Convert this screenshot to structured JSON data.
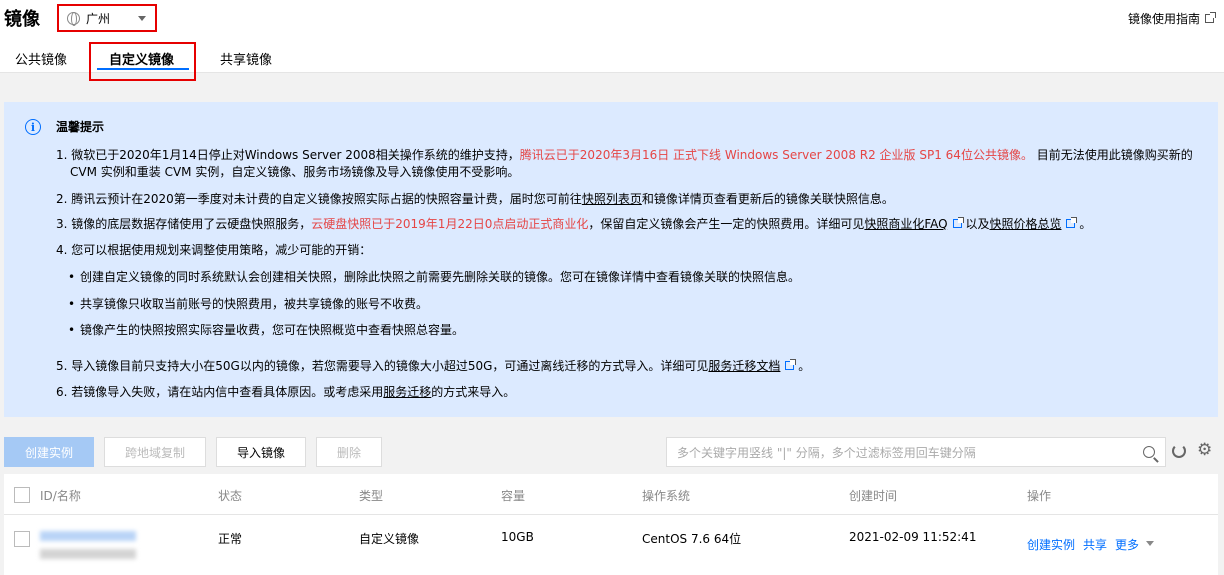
{
  "header": {
    "title": "镜像",
    "region": "广州",
    "guide_link": "镜像使用指南"
  },
  "tabs": [
    {
      "label": "公共镜像"
    },
    {
      "label": "自定义镜像"
    },
    {
      "label": "共享镜像"
    }
  ],
  "notice": {
    "title": "温馨提示",
    "l1a": "1. 微软已于2020年1月14日停止对Windows Server 2008相关操作系统的维护支持，",
    "l1b": "腾讯云已于2020年3月16日 正式下线 Windows Server 2008 R2 企业版 SP1 64位公共镜像。",
    "l1c": "目前无法使用此镜像购买新的",
    "l1d": "CVM 实例和重装 CVM 实例，自定义镜像、服务市场镜像及导入镜像使用不受影响。",
    "l2a": "2. 腾讯云预计在2020第一季度对未计费的自定义镜像按照实际占据的快照容量计费，届时您可前往",
    "l2link": "快照列表页",
    "l2b": "和镜像详情页查看更新后的镜像关联快照信息。",
    "l3a": "3. 镜像的底层数据存储使用了云硬盘快照服务，",
    "l3b": "云硬盘快照已于2019年1月22日0点启动正式商业化",
    "l3c": "，保留自定义镜像会产生一定的快照费用。详细可见",
    "l3link1": "快照商业化FAQ",
    "l3d": "以及",
    "l3link2": "快照价格总览",
    "l3e": "。",
    "l4": "4. 您可以根据使用规划来调整使用策略，减少可能的开销：",
    "b1": "创建自定义镜像的同时系统默认会创建相关快照，删除此快照之前需要先删除关联的镜像。您可在镜像详情中查看镜像关联的快照信息。",
    "b2": "共享镜像只收取当前账号的快照费用，被共享镜像的账号不收费。",
    "b3": "镜像产生的快照按照实际容量收费，您可在快照概览中查看快照总容量。",
    "l5a": "5. 导入镜像目前只支持大小在50G以内的镜像，若您需要导入的镜像大小超过50G，可通过离线迁移的方式导入。详细可见",
    "l5link": "服务迁移文档",
    "l5b": "。",
    "l6a": "6. 若镜像导入失败，请在站内信中查看具体原因。或考虑采用",
    "l6link": "服务迁移",
    "l6b": "的方式来导入。"
  },
  "toolbar": {
    "create_instance": "创建实例",
    "cross_region_copy": "跨地域复制",
    "import_image": "导入镜像",
    "delete": "删除",
    "search_placeholder": "多个关键字用竖线 \"|\" 分隔，多个过滤标签用回车键分隔"
  },
  "table": {
    "columns": [
      "ID/名称",
      "状态",
      "类型",
      "容量",
      "操作系统",
      "创建时间",
      "操作"
    ],
    "rows": [
      {
        "status": "正常",
        "type": "自定义镜像",
        "capacity": "10GB",
        "os": "CentOS 7.6 64位",
        "created": "2021-02-09 11:52:41",
        "op_create": "创建实例",
        "op_share": "共享",
        "op_more": "更多"
      }
    ]
  },
  "colors": {
    "accent": "#006eff",
    "highlight_red": "#e60000",
    "notice_bg": "#dceaff"
  }
}
